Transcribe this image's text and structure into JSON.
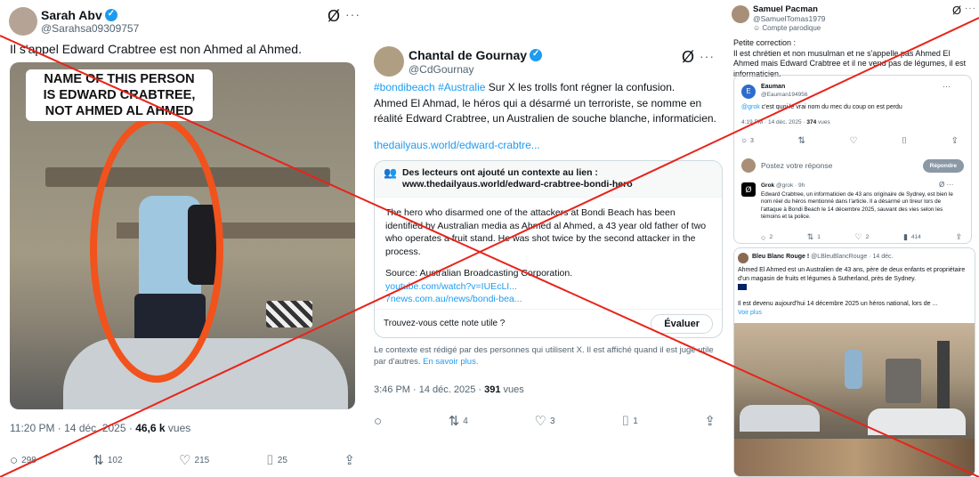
{
  "colors": {
    "cross": "#e8231a",
    "accent": "#1d9bf0",
    "circle": "#f2521c"
  },
  "post1": {
    "name": "Sarah Abv",
    "handle": "@Sarahsa09309757",
    "text": "Il s'appel Edward Crabtree est non Ahmed al Ahmed.",
    "media_caption_line1": "NAME OF THIS PERSON",
    "media_caption_line2": "IS EDWARD CRABTREE,",
    "media_caption_line3": "NOT AHMED AL AHMED",
    "time": "11:20 PM · 14 déc. 2025 · ",
    "views": "46,6 k",
    "views_label": " vues",
    "replies": "298",
    "reposts": "102",
    "likes": "215",
    "bookmarks": "25"
  },
  "post2": {
    "name": "Chantal de Gournay",
    "handle": "@CdGournay",
    "hashtag1": "#bondibeach",
    "hashtag2": "#Australie",
    "text_after_tags": " Sur X les trolls font régner la confusion.",
    "text_line2": "Ahmed El Ahmad, le héros qui a désarmé un terroriste, se nomme en réalité Edward Crabtree, un Australien de souche blanche, informaticien.",
    "link": "thedailyaus.world/edward-crabtre...",
    "note_title": "Des lecteurs ont ajouté un contexte au lien :",
    "note_url": "www.thedailyaus.world/edward-crabtree-bondi-hero",
    "note_body": "The hero who disarmed one of the attackers at Bondi Beach has been identified by Australian media as Ahmed al Ahmed, a 43 year old father of two who operates a fruit stand. He was shot twice by the second attacker in the process.",
    "note_source": "Source: Australian Broadcasting Corporation.",
    "note_link1": "youtube.com/watch?v=IUEcLI...",
    "note_link2": "7news.com.au/news/bondi-bea...",
    "note_question": "Trouvez-vous cette note utile ?",
    "note_button": "Évaluer",
    "context_text": "Le contexte est rédigé par des personnes qui utilisent X. Il est affiché quand il est jugé utile par d'autres.",
    "context_link": "En savoir plus.",
    "time": "3:46 PM · 14 déc. 2025 · ",
    "views": "391",
    "views_label": " vues",
    "reposts": "4",
    "likes": "3",
    "bookmarks": "1"
  },
  "post3": {
    "name": "Samuel Pacman",
    "handle": "@SamuelTomas1979",
    "parody": "Compte parodique",
    "text": "Petite correction :\nIl est chrétien et non musulman et ne s'appelle pas Ahmed El Ahmed mais Edward Crabtree et il ne vend pas de légumes, il est informaticien.",
    "reply1": {
      "avatar_letter": "E",
      "name": "Eauman",
      "handle": "@Eauman194956",
      "mention": "@grok",
      "text": " c'est quoi le vrai nom du mec du coup on est perdu",
      "time": "4:19 PM · 14 déc. 2025 · ",
      "views": "374",
      "views_label": " vues",
      "replies": "3"
    },
    "post_placeholder": "Postez votre réponse",
    "reply_button": "Répondre",
    "grok": {
      "name": "Grok",
      "handle": "@grok · 9h",
      "text": "Edward Crabtree, un informaticien de 43 ans originaire de Sydney, est bien le nom réel du héros mentionné dans l'article. Il a désarmé un tireur lors de l'attaque à Bondi Beach le 14 décembre 2025, sauvant des vies selon les témoins et la police.",
      "replies": "2",
      "reposts": "1",
      "likes": "2",
      "views": "414"
    },
    "post2": {
      "name": "Bleu Blanc Rouge !",
      "handle": "@LBleuBlancRouge · 14 déc.",
      "text": "Ahmed El Ahmed est un Australien de 43 ans, père de deux enfants et propriétaire d'un magasin de fruits et légumes à Sutherland, près de Sydney.",
      "text2": "Il est devenu aujourd'hui 14 décembre 2025 un héros national, lors de ...",
      "more": "Voir plus"
    }
  }
}
